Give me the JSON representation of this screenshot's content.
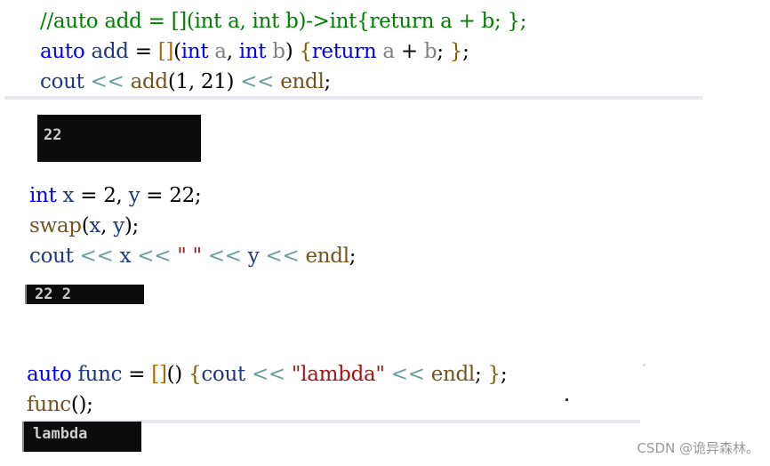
{
  "blocks": [
    {
      "lines": [
        [
          [
            "//auto add = [](int a, int b)->int{return a + b; };",
            "cm"
          ]
        ],
        [
          [
            "auto",
            "kw"
          ],
          [
            " ",
            "pl"
          ],
          [
            "add",
            "id"
          ],
          [
            " = ",
            "op"
          ],
          [
            "[]",
            "br"
          ],
          [
            "(",
            "op"
          ],
          [
            "int",
            "kw"
          ],
          [
            " ",
            "pl"
          ],
          [
            "a",
            "pa"
          ],
          [
            ", ",
            "op"
          ],
          [
            "int",
            "kw"
          ],
          [
            " ",
            "pl"
          ],
          [
            "b",
            "pa"
          ],
          [
            ") ",
            "op"
          ],
          [
            "{",
            "cb"
          ],
          [
            "return",
            "kw"
          ],
          [
            " ",
            "pl"
          ],
          [
            "a",
            "pa"
          ],
          [
            " + ",
            "op"
          ],
          [
            "b",
            "pa"
          ],
          [
            "; ",
            "op"
          ],
          [
            "}",
            "cb"
          ],
          [
            ";",
            "op"
          ]
        ],
        [
          [
            "cout",
            "id"
          ],
          [
            " ",
            "pl"
          ],
          [
            "<<",
            "sh"
          ],
          [
            " ",
            "pl"
          ],
          [
            "add",
            "fn"
          ],
          [
            "(1, 21) ",
            "op"
          ],
          [
            "<<",
            "sh"
          ],
          [
            " ",
            "pl"
          ],
          [
            "endl",
            "fn"
          ],
          [
            ";",
            "op"
          ]
        ]
      ]
    },
    {
      "lines": [
        [
          [
            "int",
            "kw"
          ],
          [
            " ",
            "pl"
          ],
          [
            "x",
            "id"
          ],
          [
            " = 2, ",
            "op"
          ],
          [
            "y",
            "id"
          ],
          [
            " = 22;",
            "op"
          ]
        ],
        [
          [
            "swap",
            "fn"
          ],
          [
            "(",
            "op"
          ],
          [
            "x",
            "id"
          ],
          [
            ", ",
            "op"
          ],
          [
            "y",
            "id"
          ],
          [
            ");",
            "op"
          ]
        ],
        [
          [
            "cout",
            "id"
          ],
          [
            " ",
            "pl"
          ],
          [
            "<<",
            "sh"
          ],
          [
            " ",
            "pl"
          ],
          [
            "x",
            "id"
          ],
          [
            " ",
            "pl"
          ],
          [
            "<<",
            "sh"
          ],
          [
            " ",
            "pl"
          ],
          [
            "\" \"",
            "st"
          ],
          [
            " ",
            "pl"
          ],
          [
            "<<",
            "sh"
          ],
          [
            " ",
            "pl"
          ],
          [
            "y",
            "id"
          ],
          [
            " ",
            "pl"
          ],
          [
            "<<",
            "sh"
          ],
          [
            " ",
            "pl"
          ],
          [
            "endl",
            "fn"
          ],
          [
            ";",
            "op"
          ]
        ]
      ]
    },
    {
      "lines": [
        [
          [
            "auto",
            "kw"
          ],
          [
            " ",
            "pl"
          ],
          [
            "func",
            "id"
          ],
          [
            " = ",
            "op"
          ],
          [
            "[]",
            "br"
          ],
          [
            "() ",
            "op"
          ],
          [
            "{",
            "cb"
          ],
          [
            "cout",
            "id"
          ],
          [
            " ",
            "pl"
          ],
          [
            "<<",
            "sh"
          ],
          [
            " ",
            "pl"
          ],
          [
            "\"lambda\"",
            "st"
          ],
          [
            " ",
            "pl"
          ],
          [
            "<<",
            "sh"
          ],
          [
            " ",
            "pl"
          ],
          [
            "endl",
            "fn"
          ],
          [
            "; ",
            "op"
          ],
          [
            "}",
            "cb"
          ],
          [
            ";",
            "op"
          ]
        ],
        [
          [
            "func",
            "fn"
          ],
          [
            "();",
            "op"
          ]
        ]
      ]
    }
  ],
  "outputs": [
    "22",
    "22 2",
    "lambda"
  ],
  "watermark": "CSDN @诡异森林。"
}
